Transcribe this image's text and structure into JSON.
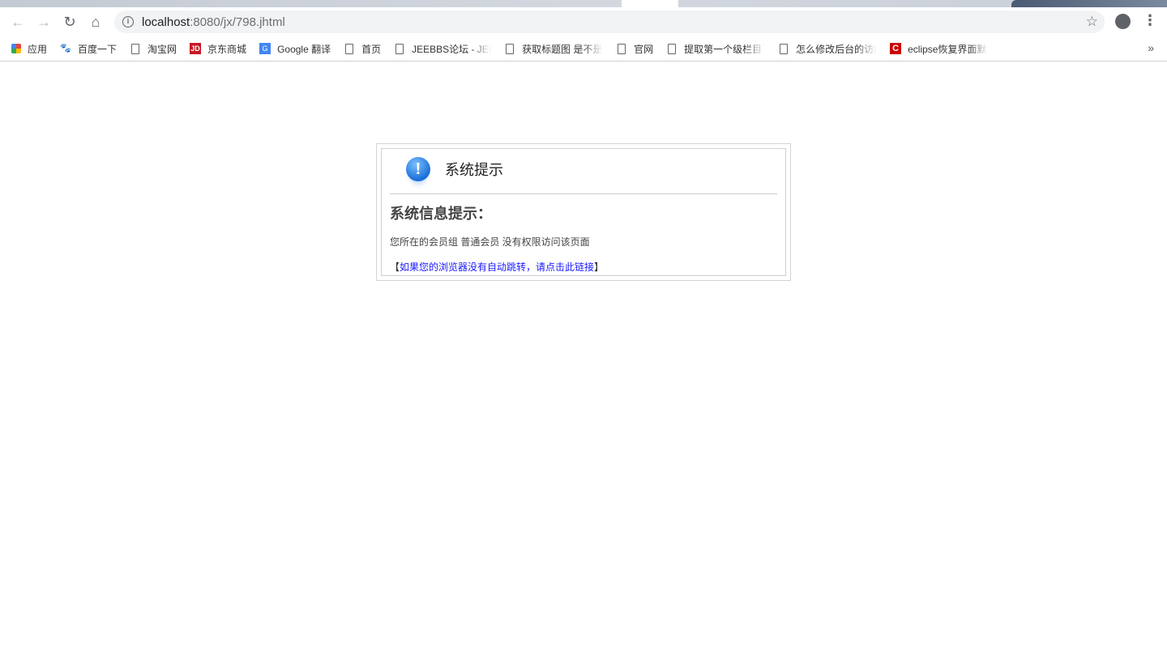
{
  "browser": {
    "url_host": "localhost",
    "url_rest": ":8080/jx/798.jhtml",
    "bookmarks": [
      {
        "label": "应用",
        "icon": "apps-grid-icon"
      },
      {
        "label": "百度一下",
        "icon": "baidu-paw-icon"
      },
      {
        "label": "淘宝网",
        "icon": "page-icon"
      },
      {
        "label": "京东商城",
        "icon": "jd-icon"
      },
      {
        "label": "Google 翻译",
        "icon": "google-translate-icon"
      },
      {
        "label": "首页",
        "icon": "page-icon"
      },
      {
        "label": "JEEBBS论坛 - JEECM",
        "icon": "page-icon"
      },
      {
        "label": "获取标题图 是不是通",
        "icon": "page-icon"
      },
      {
        "label": "官网",
        "icon": "page-icon"
      },
      {
        "label": "提取第一个级栏目下的",
        "icon": "page-icon"
      },
      {
        "label": "怎么修改后台的访问地",
        "icon": "page-icon"
      },
      {
        "label": "eclipse恢复界面默认",
        "icon": "eclipse-icon"
      }
    ],
    "more": "»"
  },
  "dialog": {
    "title": "系统提示",
    "heading": "系统信息提示：",
    "message": "您所在的会员组 普通会员 没有权限访问该页面",
    "bracket_open": "【",
    "link": "如果您的浏览器没有自动跳转，请点击此链接",
    "bracket_close": "】"
  }
}
